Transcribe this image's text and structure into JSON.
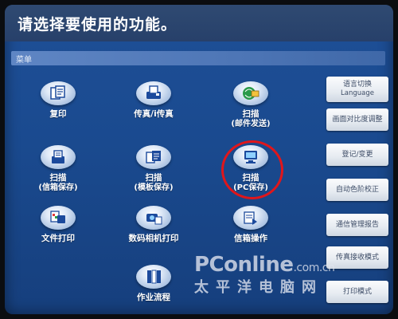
{
  "header": {
    "title": "请选择要使用的功能。"
  },
  "menu": {
    "label": "菜单"
  },
  "functions": [
    {
      "icon": "copy-icon",
      "label": "复印",
      "sub": ""
    },
    {
      "icon": "fax-icon",
      "label": "传真/i传真",
      "sub": ""
    },
    {
      "icon": "scan-email-icon",
      "label": "扫描",
      "sub": "(邮件发送)"
    },
    {
      "icon": "scan-mailbox-icon",
      "label": "扫描",
      "sub": "(信箱保存)"
    },
    {
      "icon": "scan-template-icon",
      "label": "扫描",
      "sub": "(模板保存)"
    },
    {
      "icon": "scan-pc-icon",
      "label": "扫描",
      "sub": "(PC保存)"
    },
    {
      "icon": "file-print-icon",
      "label": "文件打印",
      "sub": ""
    },
    {
      "icon": "camera-print-icon",
      "label": "数码相机打印",
      "sub": ""
    },
    {
      "icon": "mailbox-operation-icon",
      "label": "信箱操作",
      "sub": ""
    },
    {
      "icon": "job-flow-icon",
      "label": "作业流程",
      "sub": ""
    }
  ],
  "side_buttons": [
    {
      "label": "语言切换",
      "sub": "Language"
    },
    {
      "label": "画面对比度调整",
      "sub": ""
    },
    {
      "label": "登记/变更",
      "sub": ""
    },
    {
      "label": "自动色阶校正",
      "sub": ""
    },
    {
      "label": "通信管理报告",
      "sub": ""
    },
    {
      "label": "传真接收模式",
      "sub": ""
    },
    {
      "label": "打印模式",
      "sub": ""
    }
  ],
  "watermark": {
    "brand": "PConline",
    "domain": ".com.cn",
    "chinese": "太平洋电脑网"
  },
  "colors": {
    "screen_bg": "#1a4a8f",
    "title_bar": "#2f4a72",
    "highlight": "#e0161b"
  }
}
